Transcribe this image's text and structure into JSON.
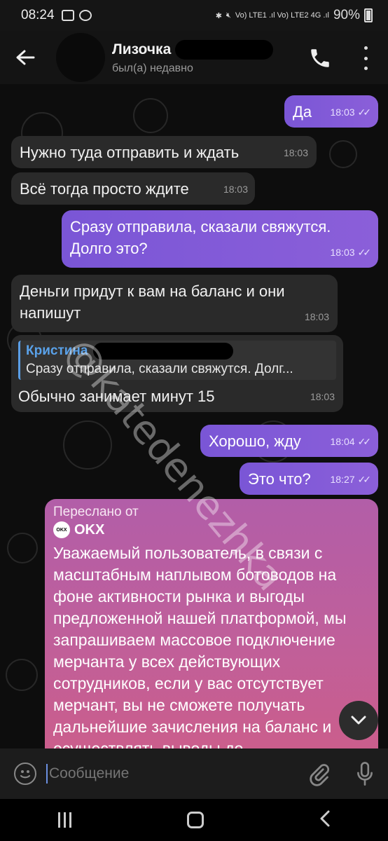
{
  "status_bar": {
    "time": "08:24",
    "network": "Vo) LTE1 .ıl Vo) LTE2 4G .ıl",
    "battery": "90%"
  },
  "header": {
    "title": "Лизочка",
    "status": "был(а) недавно"
  },
  "messages": [
    {
      "text": "Да",
      "time": "18:03",
      "direction": "out"
    },
    {
      "text": "Нужно туда отправить и ждать",
      "time": "18:03",
      "direction": "in"
    },
    {
      "text": "Всё тогда просто ждите",
      "time": "18:03",
      "direction": "in"
    },
    {
      "text": "Сразу отправила, сказали свяжутся. Долго это?",
      "time": "18:03",
      "direction": "out"
    },
    {
      "text": "Деньги придут к вам на баланс и они напишут",
      "time": "18:03",
      "direction": "in"
    },
    {
      "reply_name": "Кристина",
      "reply_text": "Сразу отправила, сказали свяжутся. Долг...",
      "text": "Обычно занимает минут 15",
      "time": "18:03",
      "direction": "in"
    },
    {
      "text": "Хорошо, жду",
      "time": "18:04",
      "direction": "out"
    },
    {
      "text": "Это что?",
      "time": "18:27",
      "direction": "out"
    }
  ],
  "forwarded": {
    "label": "Переслано от",
    "source": "OKX",
    "logo_text": "OKX",
    "body": "Уважаемый пользователь, в связи с масштабным наплывом ботоводов на фоне активности рынка и выгоды предложенной нашей платформой, мы запрашиваем массовое подключение мерчанта у всех действующих сотрудников, если у вас отсутствует мерчант, вы не сможете получать дальнейшие зачисления на баланс и осуществлять выводы до"
  },
  "watermark": "@katedenezhka",
  "composer": {
    "placeholder": "Сообщение"
  },
  "colors": {
    "outgoing": "#8b5fd9",
    "incoming": "#2a2a2a",
    "forwarded": "#bf5f9b",
    "link": "#5aa2ea"
  }
}
